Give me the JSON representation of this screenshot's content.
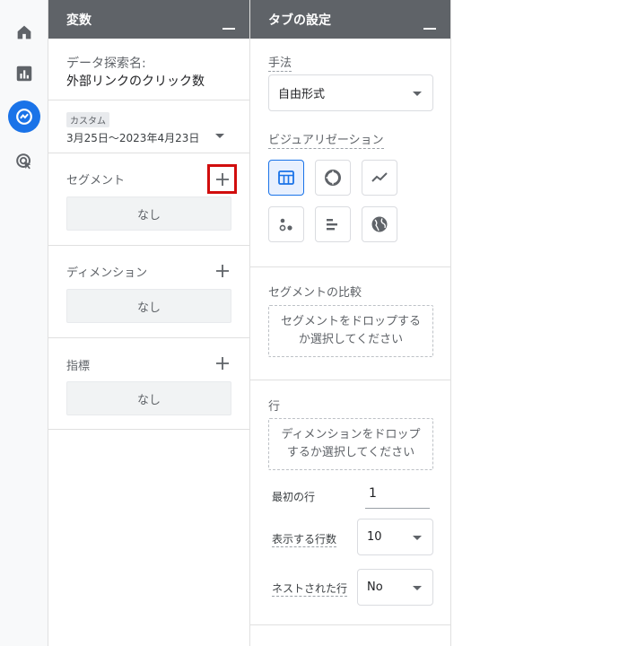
{
  "rail": {
    "items": [
      {
        "icon": "home-icon"
      },
      {
        "icon": "reports-icon"
      },
      {
        "icon": "explore-icon",
        "active": true
      },
      {
        "icon": "advertising-icon"
      }
    ],
    "active_color": "#1a73e8"
  },
  "variables": {
    "header": "変数",
    "exploration_name_label": "データ探索名:",
    "exploration_name": "外部リンクのクリック数",
    "date_badge": "カスタム",
    "date_range": "3月25日～2023年4月23日",
    "segments_label": "セグメント",
    "segments_value": "なし",
    "dimensions_label": "ディメンション",
    "dimensions_value": "なし",
    "metrics_label": "指標",
    "metrics_value": "なし"
  },
  "tab_settings": {
    "header": "タブの設定",
    "technique_label": "手法",
    "technique_value": "自由形式",
    "visualization_label": "ビジュアリゼーション",
    "viz_options": [
      {
        "icon": "table-icon",
        "selected": true
      },
      {
        "icon": "donut-chart-icon"
      },
      {
        "icon": "line-chart-icon"
      },
      {
        "icon": "scatter-plot-icon"
      },
      {
        "icon": "bar-chart-icon"
      },
      {
        "icon": "geo-map-icon"
      }
    ],
    "segment_compare_label": "セグメントの比較",
    "segment_drop_text": "セグメントをドロップするか選択してください",
    "rows_label": "行",
    "rows_drop_text": "ディメンションをドロップするか選択してください",
    "first_row_label": "最初の行",
    "first_row_value": "1",
    "rows_to_show_label": "表示する行数",
    "rows_to_show_value": "10",
    "nested_rows_label": "ネストされた行",
    "nested_rows_value": "No"
  },
  "highlight_color": "#d10d0d"
}
